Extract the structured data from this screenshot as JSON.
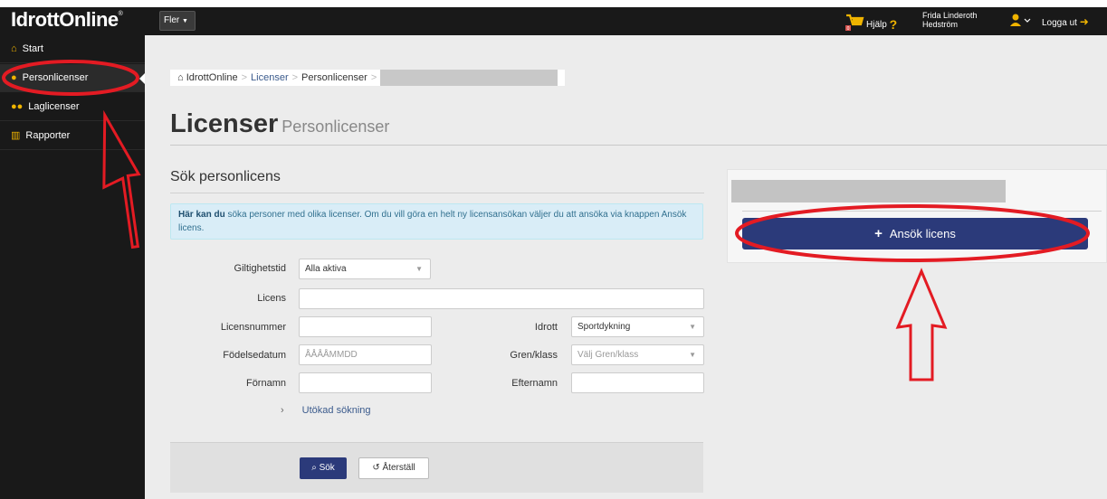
{
  "header": {
    "logo": "IdrottOnline",
    "logo_mark": "®",
    "fler_label": "Fler",
    "help_label": "Hjälp",
    "user_name": "Frida Linderoth Hedström",
    "logout_label": "Logga ut"
  },
  "sidebar": {
    "items": [
      {
        "label": "Start",
        "icon": "home-icon"
      },
      {
        "label": "Personlicenser",
        "icon": "user-icon"
      },
      {
        "label": "Laglicenser",
        "icon": "group-icon"
      },
      {
        "label": "Rapporter",
        "icon": "chart-icon"
      }
    ]
  },
  "breadcrumb": {
    "items": [
      "IdrottOnline",
      "Licenser",
      "Personlicenser"
    ],
    "separator": ">"
  },
  "page": {
    "title": "Licenser",
    "subtitle": "Personlicenser"
  },
  "search": {
    "title": "Sök personlicens",
    "info_bold": "Här kan du",
    "info_text": " söka personer med olika licenser. Om du vill göra en helt ny licensansökan väljer du att ansöka via knappen Ansök licens.",
    "giltighetstid_label": "Giltighetstid",
    "giltighetstid_value": "Alla aktiva",
    "licens_label": "Licens",
    "licens_value": "",
    "licensnummer_label": "Licensnummer",
    "licensnummer_value": "",
    "idrott_label": "Idrott",
    "idrott_value": "Sportdykning",
    "fodelsedatum_label": "Födelsedatum",
    "fodelsedatum_placeholder": "ÅÅÅÅMMDD",
    "gren_label": "Gren/klass",
    "gren_placeholder": "Välj Gren/klass",
    "fornamn_label": "Förnamn",
    "efternamn_label": "Efternamn",
    "expand_label": "Utökad sökning",
    "search_button": "Sök",
    "reset_button": "Återställ"
  },
  "apply": {
    "button_label": "Ansök licens"
  },
  "colors": {
    "primary": "#2b3a7a",
    "accent": "#f0b400",
    "annotation": "#e31b23"
  }
}
